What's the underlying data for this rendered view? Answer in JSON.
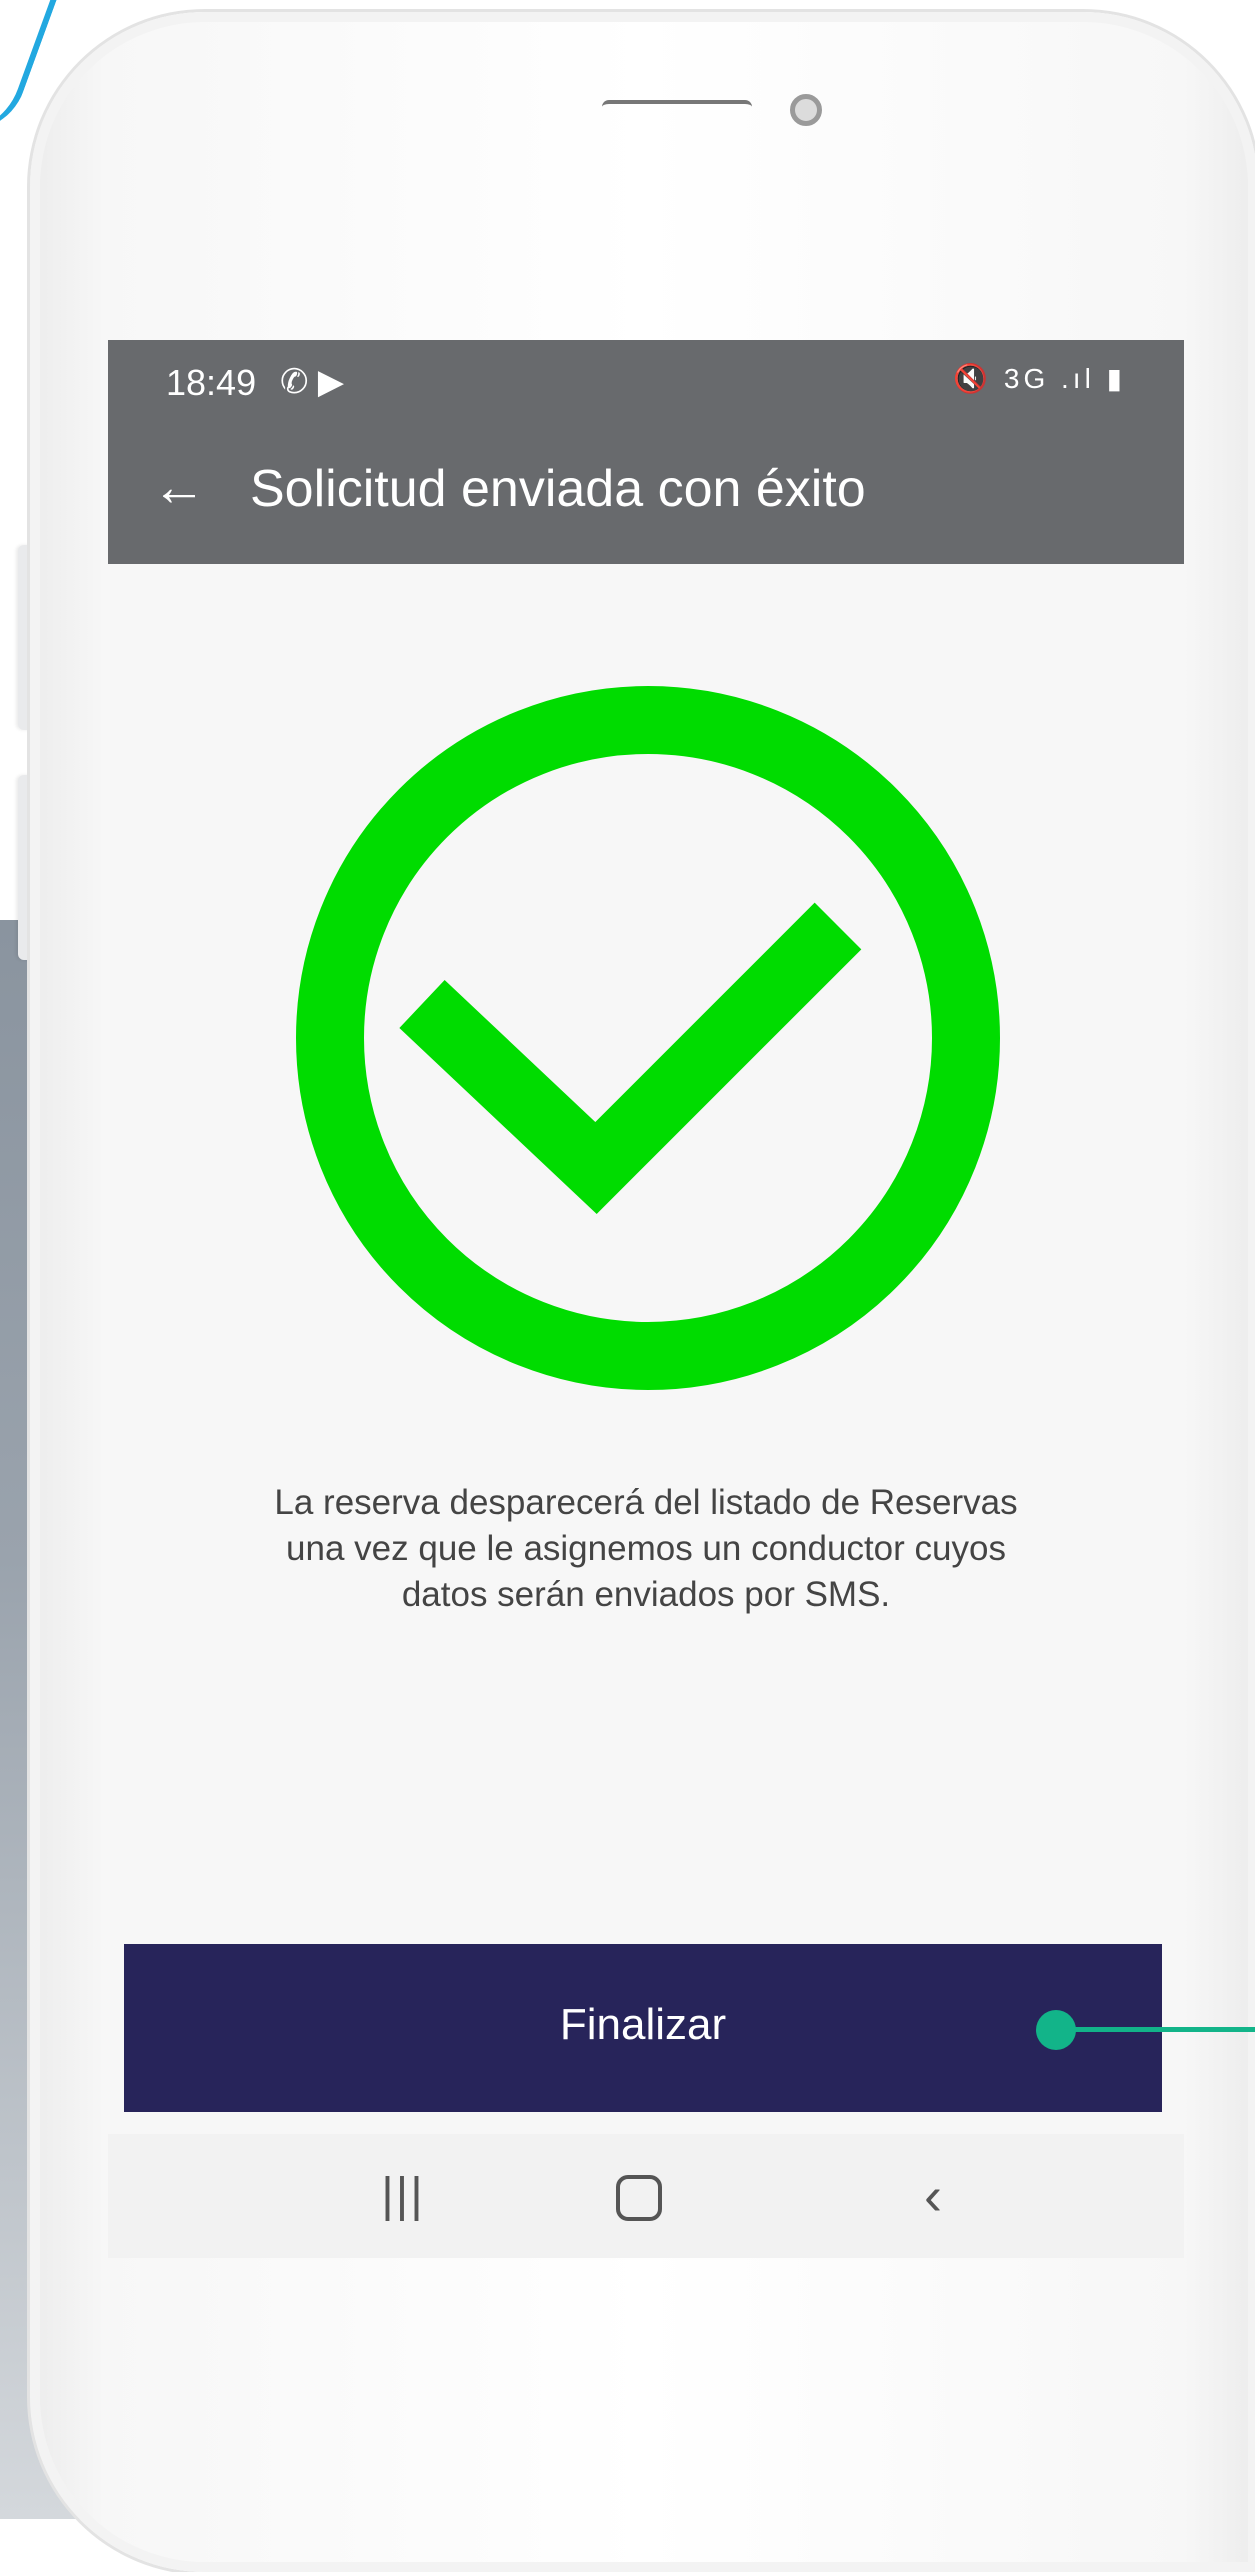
{
  "status_bar": {
    "time": "18:49",
    "left_icons": "✆ ▶",
    "right_icons": "🔇 3G .ıl ▮"
  },
  "header": {
    "back_icon": "back-arrow-icon",
    "title": "Solicitud enviada con éxito"
  },
  "success": {
    "icon": "check-circle-icon",
    "color": "#00dc00",
    "message_lines": [
      "La reserva desparecerá del listado de Reservas",
      "una vez que le asignemos un conductor cuyos",
      "datos serán enviados por SMS."
    ]
  },
  "actions": {
    "finalizar_label": "Finalizar",
    "button_color": "#27245a"
  },
  "nav_bar": {
    "recents": "|||",
    "home": "home-icon",
    "back": "‹"
  },
  "annotation": {
    "color": "#12b489"
  }
}
